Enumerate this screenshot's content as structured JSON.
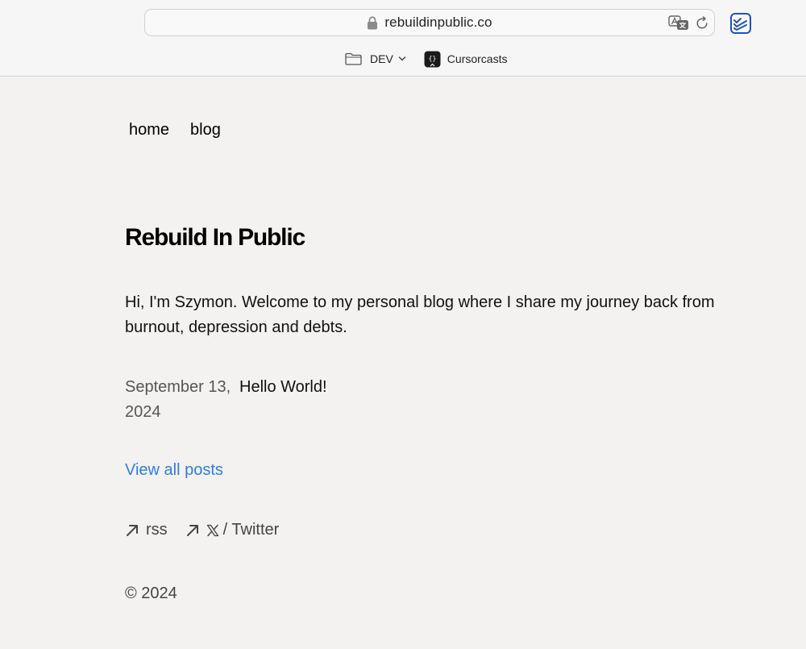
{
  "browser": {
    "url": "rebuildinpublic.co",
    "bookmarks": [
      {
        "label": "DEV",
        "icon": "folder-icon"
      },
      {
        "label": "Cursorcasts",
        "icon": "cursorcasts-favicon"
      }
    ],
    "extension_icon": "stacked-checklist-icon",
    "extension_color": "#1f4fbf"
  },
  "site": {
    "nav": {
      "home": "home",
      "blog": "blog"
    },
    "title": "Rebuild In Public",
    "intro": "Hi, I'm Szymon. Welcome to my personal blog where I share my journey back from burnout, depression and debts.",
    "posts": [
      {
        "date": "September 13, 2024",
        "title": "Hello World!"
      }
    ],
    "view_all": "View all posts",
    "footer_links": [
      {
        "label": "rss",
        "icon": "arrow-up-right-icon"
      },
      {
        "label": "/ Twitter",
        "icon": "x-logo-icon"
      }
    ],
    "copyright": "© 2024"
  },
  "colors": {
    "background": "#f3f2f1",
    "link": "#2f7de1",
    "muted_text": "#444444"
  }
}
